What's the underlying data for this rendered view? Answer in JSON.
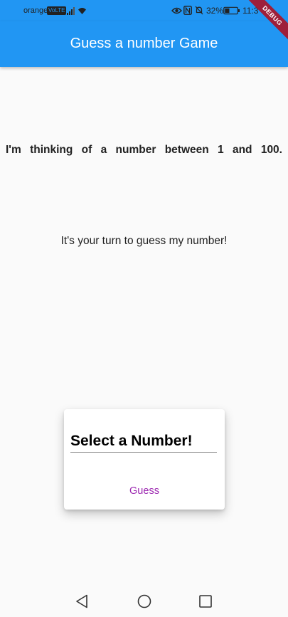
{
  "status_bar": {
    "carrier": "orange",
    "network_badge": "VoLTE",
    "battery_percent": "32%",
    "time": "11:3"
  },
  "debug_banner": "DEBUG",
  "app_bar": {
    "title": "Guess a number Game",
    "color": "#2196f3"
  },
  "main": {
    "intro": "I'm thinking of a number between 1 and 100.",
    "prompt": "It's your turn to guess my number!"
  },
  "card": {
    "input_placeholder": "Select a Number!",
    "input_value": "",
    "button_label": "Guess",
    "button_color": "#9c27b0"
  },
  "nav_bar": {
    "icons": [
      "back-icon",
      "home-icon",
      "recents-icon"
    ]
  }
}
